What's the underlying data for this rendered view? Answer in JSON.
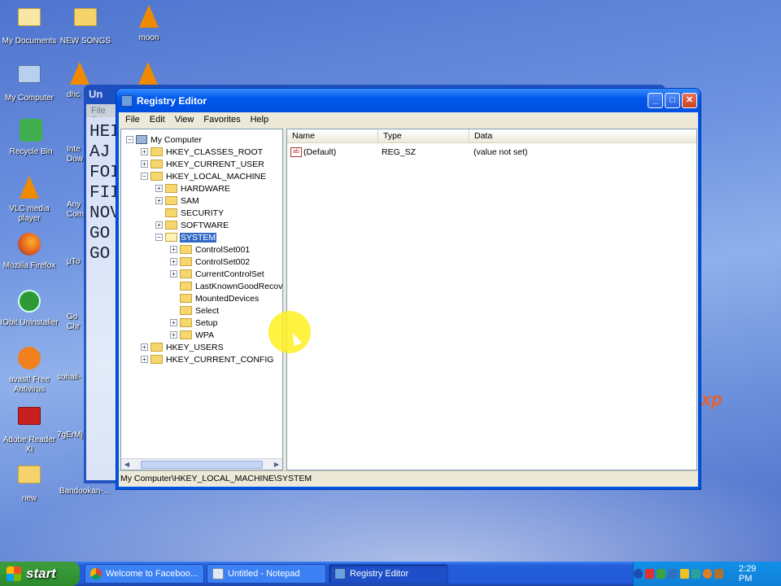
{
  "desktop": {
    "icons": [
      {
        "label": "My Documents"
      },
      {
        "label": "NEW SONGS"
      },
      {
        "label": "moon"
      },
      {
        "label": "My Computer"
      },
      {
        "label": "Recycle Bin"
      },
      {
        "label": "VLC media player"
      },
      {
        "label": "Mozilla Firefox"
      },
      {
        "label": "IObit Uninstaller"
      },
      {
        "label": "avast! Free Antivirus"
      },
      {
        "label": "Adobe Reader XI"
      },
      {
        "label": "new"
      },
      {
        "label": "dhc"
      },
      {
        "label": "Inte Dow"
      },
      {
        "label": "Any Com"
      },
      {
        "label": "µTo"
      },
      {
        "label": "Go Chr"
      },
      {
        "label": "sohail-"
      },
      {
        "label": "7gErMj"
      },
      {
        "label": "Bandookan-..."
      }
    ],
    "xp_logo_text": "xp"
  },
  "notepad": {
    "title": "Un",
    "menu": "File E",
    "lines": [
      "HEI",
      "AJ",
      "FOI",
      "FII",
      "NOV",
      "GO",
      "GO"
    ]
  },
  "regedit": {
    "title": "Registry Editor",
    "menu": [
      "File",
      "Edit",
      "View",
      "Favorites",
      "Help"
    ],
    "tree": {
      "root": "My Computer",
      "hives": [
        "HKEY_CLASSES_ROOT",
        "HKEY_CURRENT_USER",
        "HKEY_LOCAL_MACHINE"
      ],
      "hklm_children": [
        "HARDWARE",
        "SAM",
        "SECURITY",
        "SOFTWARE",
        "SYSTEM"
      ],
      "system_children": [
        "ControlSet001",
        "ControlSet002",
        "CurrentControlSet",
        "LastKnownGoodRecove",
        "MountedDevices",
        "Select",
        "Setup",
        "WPA"
      ],
      "hives_after": [
        "HKEY_USERS",
        "HKEY_CURRENT_CONFIG"
      ],
      "selected": "SYSTEM"
    },
    "columns": [
      "Name",
      "Type",
      "Data"
    ],
    "values": [
      {
        "name": "(Default)",
        "type": "REG_SZ",
        "data": "(value not set)"
      }
    ],
    "status": "My Computer\\HKEY_LOCAL_MACHINE\\SYSTEM"
  },
  "taskbar": {
    "start": "start",
    "tasks": [
      {
        "label": "Welcome to Faceboo..."
      },
      {
        "label": "Untitled - Notepad"
      },
      {
        "label": "Registry Editor"
      }
    ],
    "clock": "2:29 PM"
  }
}
